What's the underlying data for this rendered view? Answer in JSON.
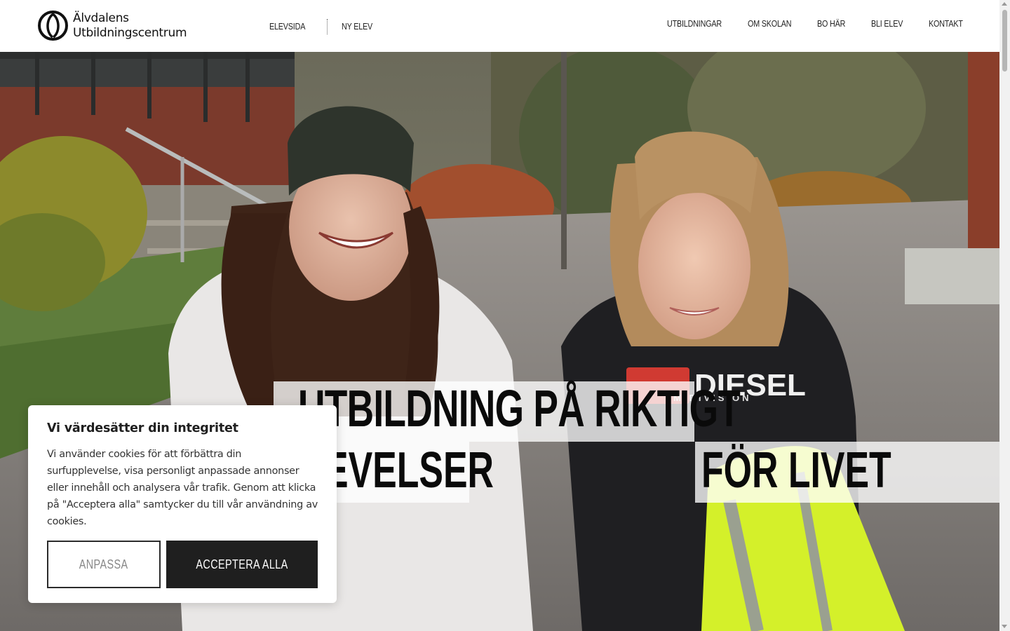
{
  "header": {
    "logo": {
      "line1": "Älvdalens",
      "line2": "Utbildningscentrum"
    },
    "nav_left": [
      "ELEVSIDA",
      "NY ELEV"
    ],
    "nav_right": [
      "UTBILDNINGAR",
      "OM SKOLAN",
      "BO HÄR",
      "BLI ELEV",
      "KONTAKT"
    ]
  },
  "hero": {
    "headline_line1": "UTBILDNING PÅ RIKTIGT",
    "headline_line2_left": "EVELSER",
    "headline_line2_right": "FÖR LIVET",
    "shirt_print": "DIESEL",
    "shirt_print_sub": "M DIVISION"
  },
  "cookie": {
    "title": "Vi värdesätter din integritet",
    "body": "Vi använder cookies för att förbättra din surfupplevelse, visa personligt anpassade annonser eller innehåll och analysera vår trafik. Genom att klicka på \"Acceptera alla\" samtycker du till vår användning av cookies.",
    "customize_label": "ANPASSA",
    "accept_label": "ACCEPTERA ALLA"
  },
  "colors": {
    "accept_bg": "#1f1f1f",
    "safety_jacket": "#d4f02a"
  }
}
